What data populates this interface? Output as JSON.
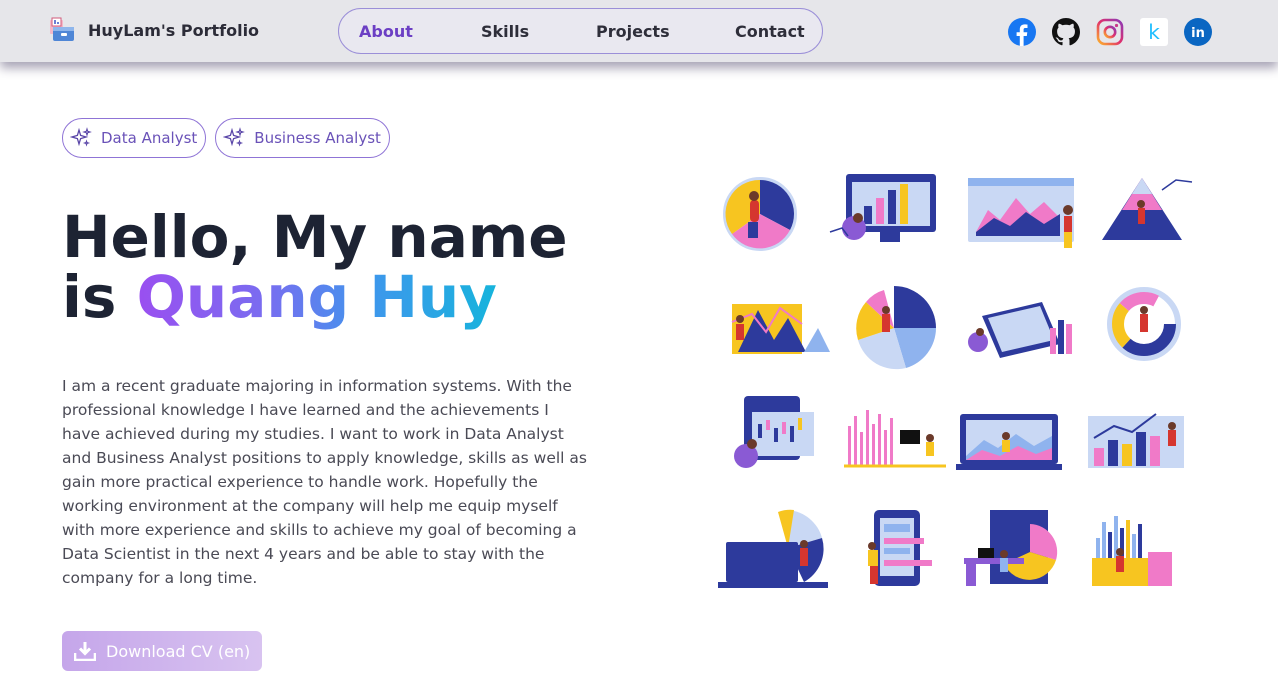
{
  "brand": {
    "name": "HuyLam's Portfolio",
    "logo": "portfolio-folder-icon"
  },
  "nav": {
    "links": [
      {
        "label": "About",
        "active": true
      },
      {
        "label": "Skills",
        "active": false
      },
      {
        "label": "Projects",
        "active": false
      },
      {
        "label": "Contact",
        "active": false
      }
    ]
  },
  "socials": [
    {
      "icon": "facebook-icon",
      "color": "#1877f2"
    },
    {
      "icon": "github-icon",
      "color": "#111111"
    },
    {
      "icon": "instagram-icon",
      "color": "#e1306c"
    },
    {
      "icon": "kaggle-icon",
      "color": "#20beff",
      "glyph": "k"
    },
    {
      "icon": "linkedin-icon",
      "color": "#0a66c2",
      "glyph": "in"
    }
  ],
  "tags": [
    "Data Analyst",
    "Business Analyst"
  ],
  "hero": {
    "greeting": "Hello, My name",
    "is_word": "is",
    "name": "Quang Huy"
  },
  "bio": "I am a recent graduate majoring in information systems. With the professional knowledge I have learned and the achievements I have achieved during my studies. I want to work in Data Analyst and Business Analyst positions to apply knowledge, skills as well as gain more practical experience to handle work. Hopefully the working environment at the company will help me equip myself with more experience and skills to achieve my goal of becoming a Data Scientist in the next 4 years and be able to stay with the company for a long time.",
  "download": {
    "label": "Download CV (en)"
  },
  "colors": {
    "accent": "#6c3fc4",
    "navy": "#2d3a9c",
    "yellow": "#f7c520",
    "pink": "#f07ac8",
    "sky": "#8fb3ee"
  },
  "gallery": {
    "illustrations": [
      "pie-chart-analyst",
      "monitor-bar-chart",
      "browser-area-chart",
      "pyramid-chart",
      "mountain-chart",
      "radial-chart",
      "calendar-analytics",
      "donut-chart",
      "candlestick-tablet",
      "histogram-desk",
      "laptop-waves",
      "bar-chart-growth",
      "laptop-pie",
      "phone-dashboard",
      "office-desk-pie",
      "bar-chart-workspace"
    ]
  }
}
